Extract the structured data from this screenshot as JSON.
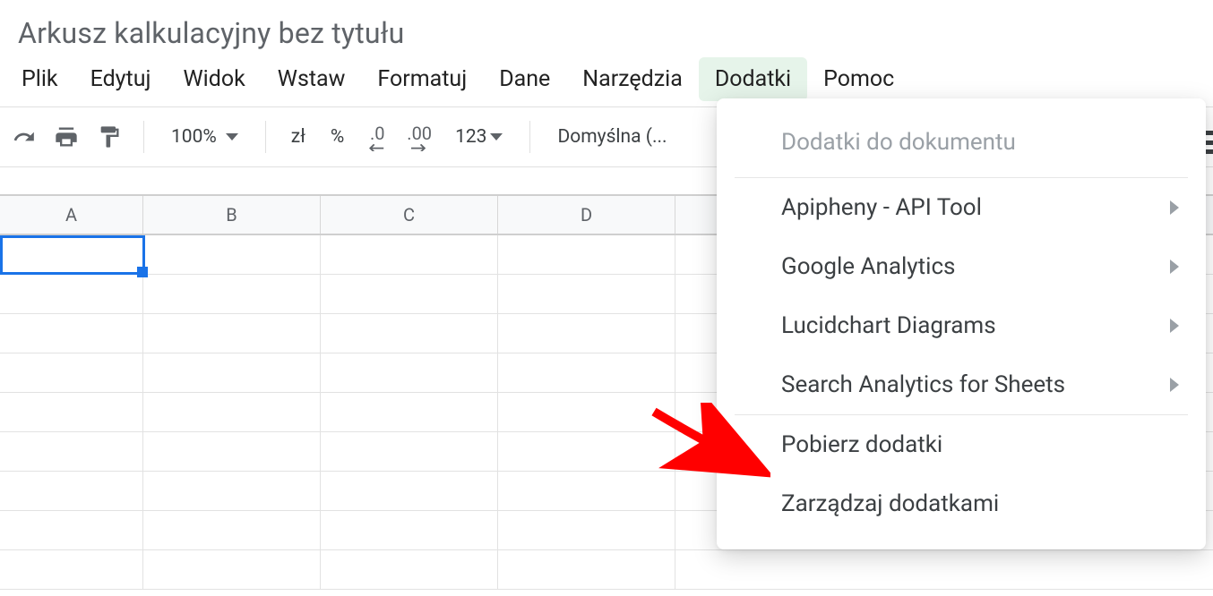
{
  "doc_title": "Arkusz kalkulacyjny bez tytułu",
  "menubar": {
    "items": [
      {
        "label": "Plik",
        "name": "menu-file"
      },
      {
        "label": "Edytuj",
        "name": "menu-edit"
      },
      {
        "label": "Widok",
        "name": "menu-view"
      },
      {
        "label": "Wstaw",
        "name": "menu-insert"
      },
      {
        "label": "Formatuj",
        "name": "menu-format"
      },
      {
        "label": "Dane",
        "name": "menu-data"
      },
      {
        "label": "Narzędzia",
        "name": "menu-tools"
      },
      {
        "label": "Dodatki",
        "name": "menu-addons",
        "active": true
      },
      {
        "label": "Pomoc",
        "name": "menu-help"
      }
    ]
  },
  "toolbar": {
    "zoom": "100%",
    "currency_label": "zł",
    "percent_label": "%",
    "dec_dec_label": ".0",
    "dec_inc_label": ".00",
    "num_format_label": "123",
    "font_label": "Domyślna (..."
  },
  "columns": [
    "A",
    "B",
    "C",
    "D"
  ],
  "dropdown": {
    "header": "Dodatki do dokumentu",
    "submenus": [
      "Apipheny - API Tool",
      "Google Analytics",
      "Lucidchart Diagrams",
      "Search Analytics for Sheets"
    ],
    "actions": [
      "Pobierz dodatki",
      "Zarządzaj dodatkami"
    ]
  }
}
